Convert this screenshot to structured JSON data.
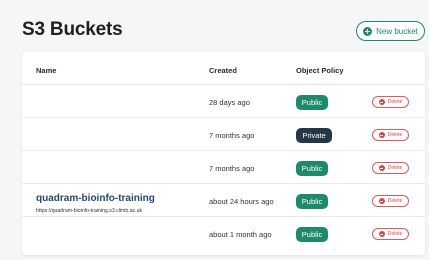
{
  "page": {
    "title": "S3 Buckets",
    "new_button_label": "New bucket"
  },
  "table": {
    "headers": {
      "name": "Name",
      "created": "Created",
      "policy": "Object Policy"
    },
    "rows": [
      {
        "name": "",
        "url": "",
        "created": "28 days ago",
        "policy": "Public",
        "delete_label": "Delete"
      },
      {
        "name": "",
        "url": "",
        "created": "7 months ago",
        "policy": "Private",
        "delete_label": "Delete"
      },
      {
        "name": "",
        "url": "",
        "created": "7 months ago",
        "policy": "Public",
        "delete_label": "Delete"
      },
      {
        "name": "quadram-bioinfo-training",
        "url": "https://quadram-bioinfo-training.s3.climb.ac.uk",
        "created": "about 24 hours ago",
        "policy": "Public",
        "delete_label": "Delete"
      },
      {
        "name": "",
        "url": "",
        "created": "about 1 month ago",
        "policy": "Public",
        "delete_label": "Delete"
      }
    ]
  },
  "colors": {
    "public": "#1e8a6a",
    "private": "#243746",
    "danger": "#d64545",
    "link": "#24496e"
  }
}
